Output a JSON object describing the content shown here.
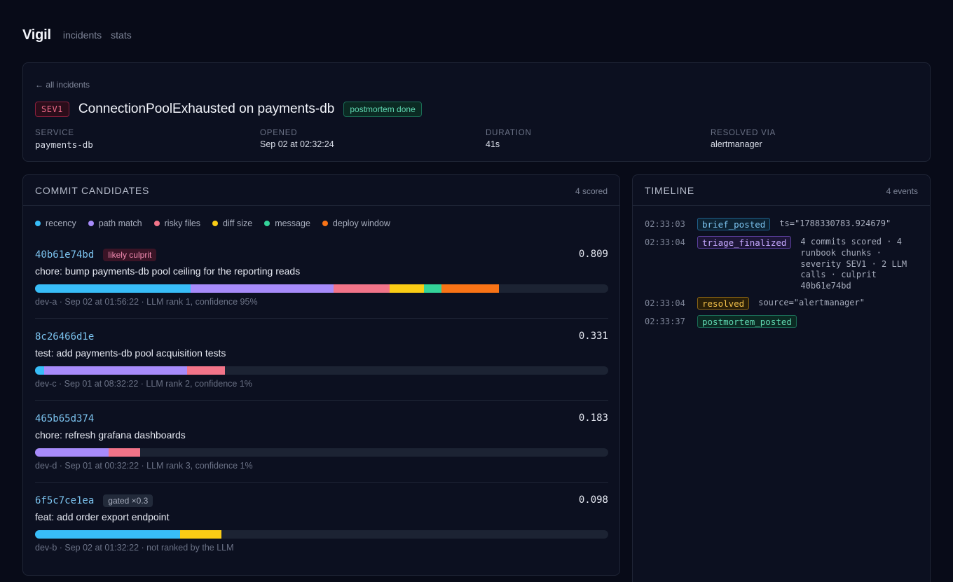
{
  "nav": {
    "brand": "Vigil",
    "links": [
      "incidents",
      "stats"
    ]
  },
  "incident": {
    "back_link": "← all incidents",
    "severity": "SEV1",
    "title": "ConnectionPoolExhausted on payments-db",
    "status": "postmortem done",
    "meta": [
      {
        "label": "SERVICE",
        "value": "payments-db"
      },
      {
        "label": "OPENED",
        "value": "Sep 02 at 02:32:24"
      },
      {
        "label": "DURATION",
        "value": "41s"
      },
      {
        "label": "RESOLVED VIA",
        "value": "alertmanager"
      }
    ]
  },
  "commits": {
    "title": "COMMIT CANDIDATES",
    "count": "4 scored",
    "legend": [
      {
        "name": "recency",
        "color": "#38bdf8"
      },
      {
        "name": "path match",
        "color": "#a78bfa"
      },
      {
        "name": "risky files",
        "color": "#f27489"
      },
      {
        "name": "diff size",
        "color": "#facc15"
      },
      {
        "name": "message",
        "color": "#34d399"
      },
      {
        "name": "deploy window",
        "color": "#f97316"
      }
    ],
    "items": [
      {
        "sha": "40b61e74bd",
        "badge": "likely culprit",
        "badge_kind": "culprit",
        "score": "0.809",
        "message": "chore: bump payments-db pool ceiling for the reporting reads",
        "components": [
          0.272,
          0.249,
          0.097,
          0.061,
          0.03,
          0.1
        ],
        "sub": "dev-a · Sep 02 at 01:56:22 · LLM rank 1, confidence 95%"
      },
      {
        "sha": "8c26466d1e",
        "badge": "",
        "badge_kind": "",
        "score": "0.331",
        "message": "test: add payments-db pool acquisition tests",
        "components": [
          0.016,
          0.249,
          0.066,
          0,
          0,
          0
        ],
        "sub": "dev-c · Sep 01 at 08:32:22 · LLM rank 2, confidence 1%"
      },
      {
        "sha": "465b65d374",
        "badge": "",
        "badge_kind": "",
        "score": "0.183",
        "message": "chore: refresh grafana dashboards",
        "components": [
          0,
          0.128,
          0.055,
          0,
          0,
          0
        ],
        "sub": "dev-d · Sep 01 at 00:32:22 · LLM rank 3, confidence 1%"
      },
      {
        "sha": "6f5c7ce1ea",
        "badge": "gated ×0.3",
        "badge_kind": "gated",
        "score": "0.098",
        "message": "feat: add order export endpoint",
        "components": [
          0.253,
          0,
          0,
          0.072,
          0,
          0
        ],
        "sub": "dev-b · Sep 02 at 01:32:22 · not ranked by the LLM"
      }
    ]
  },
  "timeline": {
    "title": "TIMELINE",
    "count": "4 events",
    "events": [
      {
        "time": "02:33:03",
        "tag": "brief_posted",
        "color": "blue",
        "detail": "ts=\"1788330783.924679\""
      },
      {
        "time": "02:33:04",
        "tag": "triage_finalized",
        "color": "purple",
        "detail": "4 commits scored · 4 runbook chunks · severity SEV1 · 2 LLM calls · culprit 40b61e74bd"
      },
      {
        "time": "02:33:04",
        "tag": "resolved",
        "color": "amber",
        "detail": "source=\"alertmanager\""
      },
      {
        "time": "02:33:37",
        "tag": "postmortem_posted",
        "color": "green",
        "detail": ""
      }
    ]
  }
}
